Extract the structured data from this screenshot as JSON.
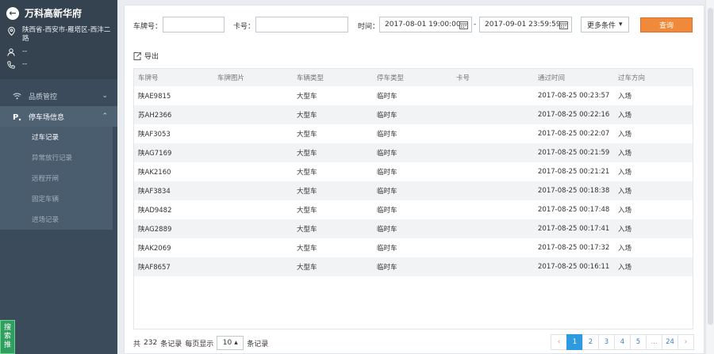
{
  "sidebar": {
    "title": "万科高新华府",
    "address": "陕西省-西安市-雁塔区-西沣二路",
    "user": "--",
    "phone": "--",
    "menu": [
      {
        "label": "品质管控",
        "icon": "wifi-icon"
      },
      {
        "label": "停车场信息",
        "icon": "parking-icon"
      }
    ],
    "submenu": [
      "过车记录",
      "异常放行记录",
      "远程开闸",
      "固定车辆",
      "进场记录"
    ],
    "side_tag": "搜索推"
  },
  "filter": {
    "plate_label": "车牌号：",
    "plate_value": "",
    "card_label": "卡号：",
    "card_value": "",
    "time_label": "时间：",
    "start_time": "2017-08-01 19:00:00",
    "end_time": "2017-09-01 23:59:59",
    "dash": "-",
    "more_label": "更多条件",
    "query_label": "查询"
  },
  "toolbar": {
    "export_label": "导出"
  },
  "table": {
    "headers": [
      "车牌号",
      "车牌图片",
      "车辆类型",
      "停车类型",
      "卡号",
      "通过时间",
      "过车方向"
    ],
    "rows": [
      [
        "陕AE9815",
        "",
        "大型车",
        "临时车",
        "",
        "2017-08-25 00:23:57",
        "入场"
      ],
      [
        "苏AH2366",
        "",
        "大型车",
        "临时车",
        "",
        "2017-08-25 00:22:16",
        "入场"
      ],
      [
        "陕AF3053",
        "",
        "大型车",
        "临时车",
        "",
        "2017-08-25 00:22:07",
        "入场"
      ],
      [
        "陕AG7169",
        "",
        "大型车",
        "临时车",
        "",
        "2017-08-25 00:21:59",
        "入场"
      ],
      [
        "陕AK2160",
        "",
        "大型车",
        "临时车",
        "",
        "2017-08-25 00:21:21",
        "入场"
      ],
      [
        "陕AF3834",
        "",
        "大型车",
        "临时车",
        "",
        "2017-08-25 00:18:38",
        "入场"
      ],
      [
        "陕AD9482",
        "",
        "大型车",
        "临时车",
        "",
        "2017-08-25 00:17:48",
        "入场"
      ],
      [
        "陕AG2889",
        "",
        "大型车",
        "临时车",
        "",
        "2017-08-25 00:17:41",
        "入场"
      ],
      [
        "陕AK2069",
        "",
        "大型车",
        "临时车",
        "",
        "2017-08-25 00:17:32",
        "入场"
      ],
      [
        "陕AF8657",
        "",
        "大型车",
        "临时车",
        "",
        "2017-08-25 00:16:11",
        "入场"
      ]
    ]
  },
  "footer": {
    "total_prefix": "共",
    "total": "232",
    "total_suffix": "条记录",
    "per_page_label": "每页显示",
    "page_size": "10",
    "per_page_suffix": "条记录",
    "pages": [
      "‹",
      "1",
      "2",
      "3",
      "4",
      "5",
      "...",
      "24",
      "›"
    ],
    "current_page": "1"
  },
  "colors": {
    "sidebar_bg": "#3b4b5c",
    "query_button": "#f08a3a",
    "pager_active": "#2e9ae0",
    "side_tag": "#2f9e5e"
  }
}
